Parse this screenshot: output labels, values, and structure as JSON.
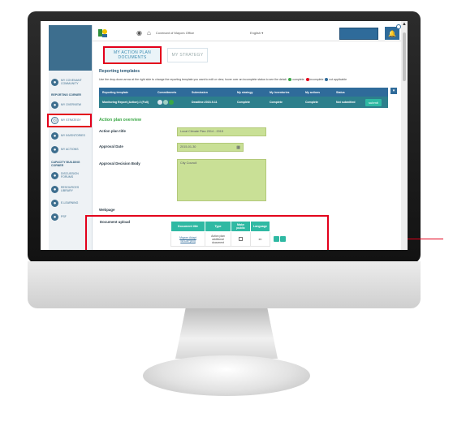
{
  "header": {
    "covenant_link": "Covenant of Mayors Office",
    "language": "English",
    "language_caret": "▾"
  },
  "tabs": [
    {
      "label": "MY ACTION PLAN DOCUMENTS"
    },
    {
      "label": "MY STRATEGY"
    }
  ],
  "sidebar": {
    "items": [
      {
        "label": "MY COVENANT COMMUNITY",
        "icon": "community-icon"
      },
      {
        "label": "MY OVERVIEW",
        "icon": "overview-icon"
      },
      {
        "label": "MY STRATEGY",
        "icon": "strategy-icon"
      },
      {
        "label": "MY INVENTORIES",
        "icon": "inventories-icon"
      },
      {
        "label": "MY ACTIONS",
        "icon": "actions-icon"
      },
      {
        "label": "DISCUSSION FORUMS",
        "icon": "forum-icon"
      },
      {
        "label": "RESOURCES LIBRARY",
        "icon": "library-icon"
      },
      {
        "label": "E-LEARNING",
        "icon": "elearning-icon"
      },
      {
        "label": "PSF",
        "icon": "psf-icon"
      }
    ],
    "section_reporting": "REPORTING CORNER",
    "section_capacity": "CAPACITY BUILDING CORNER"
  },
  "reporting": {
    "title": "Reporting templates",
    "helper": "Use the drop-down arrow at the right side to change the reporting template you want to edit or view; hover over an incomplete status to see the detail:",
    "legend_complete": "complete",
    "legend_incomplete": "incomplete",
    "legend_not_applicable": "not applicable",
    "columns": [
      "Reporting template",
      "Commitments",
      "Submission",
      "My strategy",
      "My inventories",
      "My actions",
      "Status"
    ],
    "row": {
      "template": "Monitoring Report (Action) 2 (Full)",
      "submission": "Deadline:2015-9-11",
      "strategy": "Complete",
      "inventories": "Complete",
      "actions": "Complete",
      "status": "Not submitted",
      "submit_label": "submit"
    }
  },
  "overview": {
    "title": "Action plan overview",
    "plan_title_label": "Action plan title",
    "plan_title_value": "Local Climate Plan 2014 - 2015",
    "approval_date_label": "Approval Date",
    "approval_date_value": "2015-01-30",
    "approval_body_label": "Approval Decision Body",
    "approval_body_value": "City Council",
    "webpage_label": "Webpage"
  },
  "documents": {
    "label": "Document upload",
    "columns": [
      "Document title",
      "Type",
      "Make public",
      "Language"
    ],
    "rows": [
      {
        "title": "Mayors Adapt SECAP(EN)",
        "type": "Action plan additional document",
        "language": "en"
      }
    ]
  },
  "colors": {
    "accent_red": "#e3001b",
    "brand_blue": "#2f6b9a",
    "teal": "#2fb9a3",
    "field_green": "#c9e096"
  }
}
